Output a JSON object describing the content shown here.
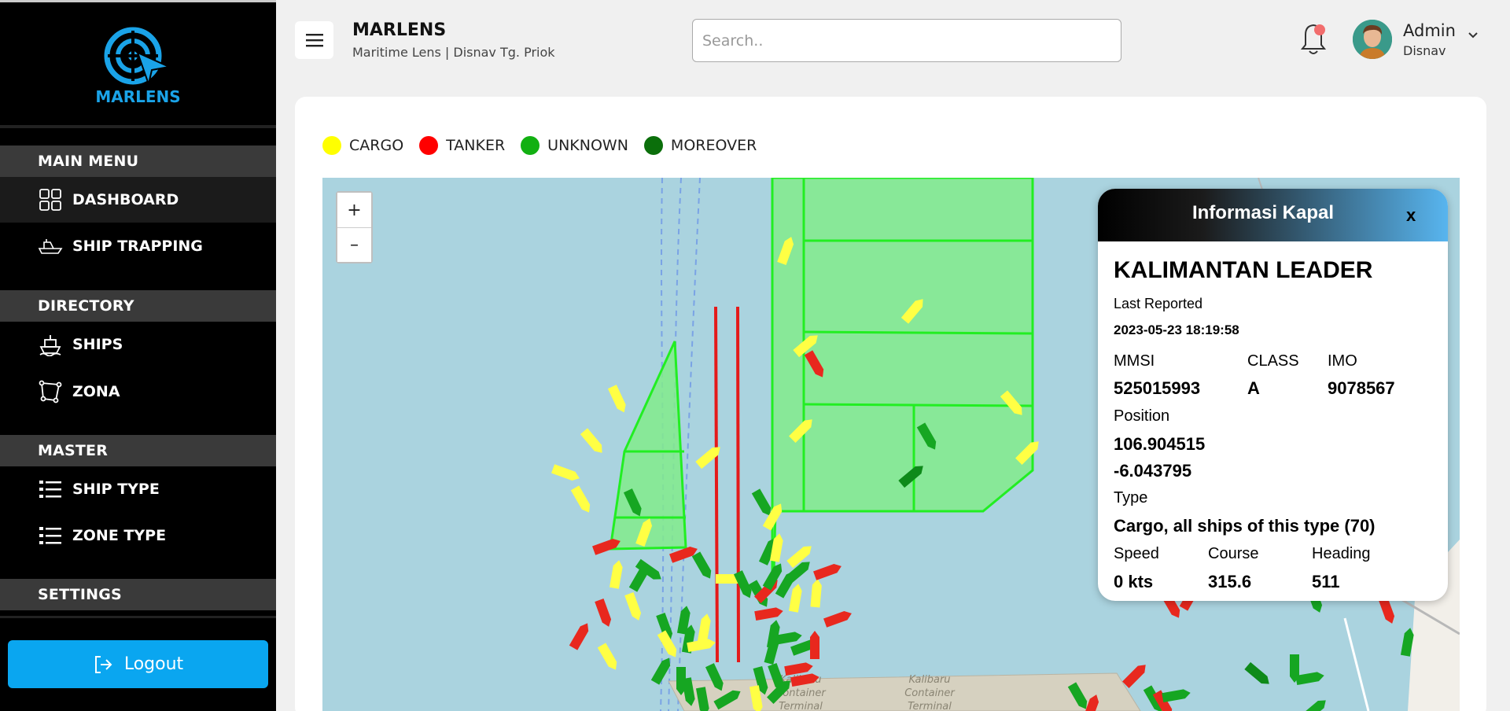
{
  "brand": {
    "name": "MARLENS"
  },
  "sidebar": {
    "sections": [
      {
        "title": "MAIN MENU"
      },
      {
        "title": "DIRECTORY"
      },
      {
        "title": "MASTER"
      },
      {
        "title": "SETTINGS"
      }
    ],
    "items": [
      {
        "label": "DASHBOARD",
        "icon": "dashboard-icon"
      },
      {
        "label": "SHIP TRAPPING",
        "icon": "ship-trapping-icon"
      },
      {
        "label": "SHIPS",
        "icon": "ship-icon"
      },
      {
        "label": "ZONA",
        "icon": "polygon-icon"
      },
      {
        "label": "SHIP TYPE",
        "icon": "list-icon"
      },
      {
        "label": "ZONE TYPE",
        "icon": "list-icon"
      }
    ],
    "logout_label": "Logout"
  },
  "header": {
    "title": "MARLENS",
    "subtitle": "Maritime Lens | Disnav Tg. Priok",
    "search_placeholder": "Search..",
    "user_name": "Admin",
    "user_role": "Disnav"
  },
  "legend": [
    {
      "label": "CARGO",
      "color": "#ffff00"
    },
    {
      "label": "TANKER",
      "color": "#ff0000"
    },
    {
      "label": "UNKNOWN",
      "color": "#12b012"
    },
    {
      "label": "MOREOVER",
      "color": "#0b6f0b"
    }
  ],
  "map": {
    "zoom_in": "+",
    "zoom_out": "–",
    "labels": {
      "terminal_a": [
        "Kalibaru",
        "Container",
        "Terminal"
      ],
      "terminal_b": [
        "Kalibaru",
        "Container",
        "Terminal"
      ]
    }
  },
  "info": {
    "title": "Informasi Kapal",
    "close": "x",
    "ship_name": "KALIMANTAN LEADER",
    "last_reported_label": "Last Reported",
    "last_reported": "2023-05-23 18:19:58",
    "mmsi_label": "MMSI",
    "mmsi": "525015993",
    "class_label": "CLASS",
    "class": "A",
    "imo_label": "IMO",
    "imo": "9078567",
    "position_label": "Position",
    "lon": "106.904515",
    "lat": "-6.043795",
    "type_label": "Type",
    "type": "Cargo, all ships of this type (70)",
    "speed_label": "Speed",
    "speed": "0 kts",
    "course_label": "Course",
    "course": "315.6",
    "heading_label": "Heading",
    "heading": "511"
  }
}
